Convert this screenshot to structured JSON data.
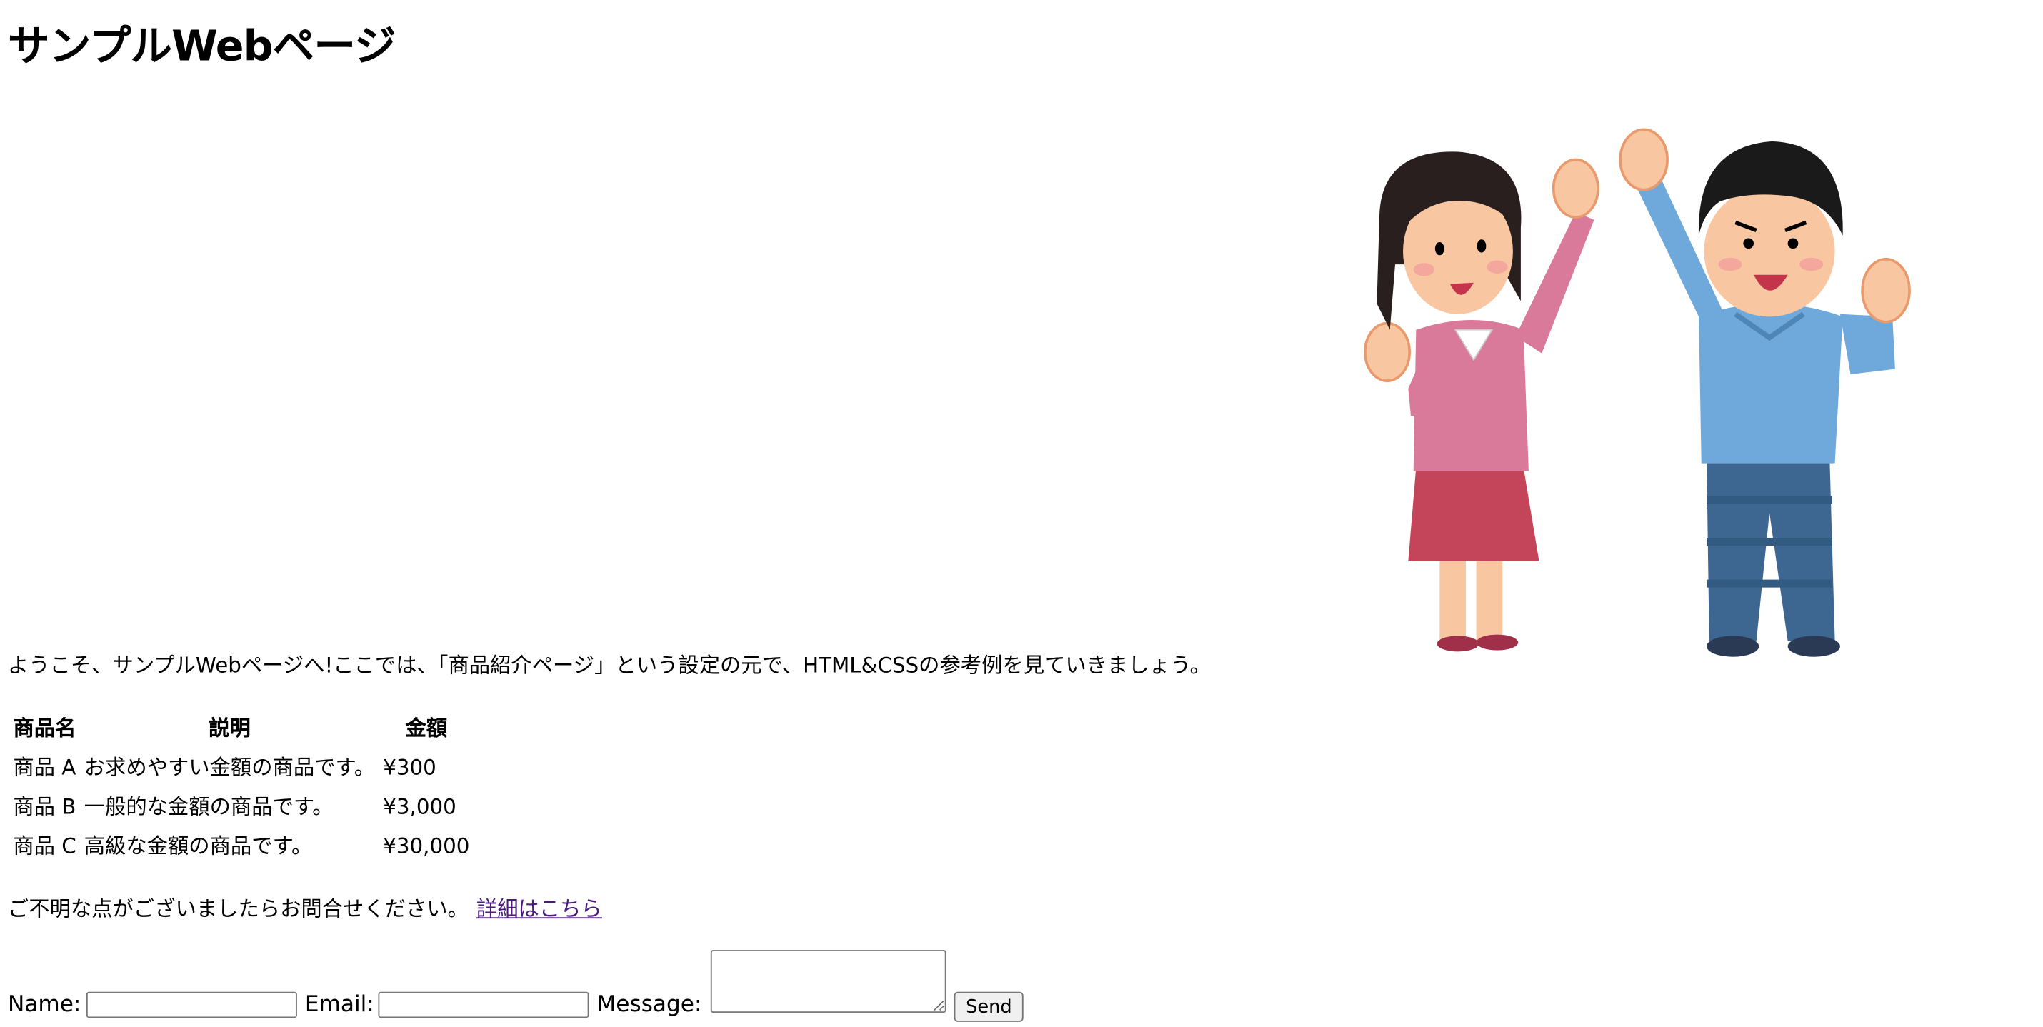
{
  "page": {
    "title": "サンプルWebページ"
  },
  "hero_image": {
    "description_icon": "cheering-couple-illustration",
    "colors": {
      "woman_top": "#d97a9b",
      "woman_skirt": "#c4455a",
      "man_top": "#6fa8da",
      "man_pants": "#3d6790",
      "skin": "#f8c6a0",
      "hair": "#2a1f1f"
    }
  },
  "intro": {
    "text": "ようこそ、サンプルWebページへ!ここでは、「商品紹介ページ」という設定の元で、HTML&CSSの参考例を見ていきましょう。"
  },
  "products": {
    "headers": [
      "商品名",
      "説明",
      "金額"
    ],
    "rows": [
      [
        "商品 A",
        "お求めやすい金額の商品です。",
        "¥300"
      ],
      [
        "商品 B",
        "一般的な金額の商品です。",
        "¥3,000"
      ],
      [
        "商品 C",
        "高級な金額の商品です。",
        "¥30,000"
      ]
    ]
  },
  "note": {
    "text": "ご不明な点がございましたらお問合せください。",
    "link_label": "詳細はこちら"
  },
  "contact": {
    "name_label": "Name:",
    "name_value": "",
    "email_label": "Email:",
    "email_value": "",
    "message_label": "Message:",
    "message_value": "",
    "send_label": "Send"
  }
}
